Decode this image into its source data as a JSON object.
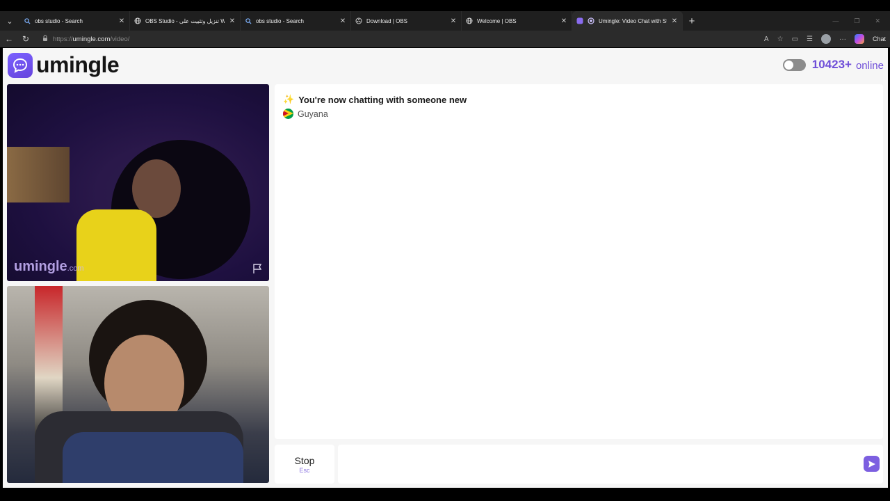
{
  "browser": {
    "tabs": [
      {
        "title": "obs studio - Search",
        "icon": "search-icon"
      },
      {
        "title": "OBS Studio - تنزيل وتثبيت على Wi",
        "icon": "globe-icon"
      },
      {
        "title": "obs studio - Search",
        "icon": "search-icon"
      },
      {
        "title": "Download | OBS",
        "icon": "obs-icon"
      },
      {
        "title": "Welcome | OBS",
        "icon": "globe-icon"
      },
      {
        "title": "Umingle: Video Chat with Stra",
        "icon": "umingle-icon",
        "active": true
      }
    ],
    "url": {
      "scheme": "https://",
      "host": "umingle.com",
      "path": "/video/"
    },
    "chat_button": "Chat"
  },
  "header": {
    "logo_text": "umingle",
    "online_count": "10423+",
    "online_label": "online",
    "toggle_on": false
  },
  "videos": {
    "remote_watermark": "umingle",
    "remote_watermark_suffix": ".com"
  },
  "chat": {
    "status_message": "You're now chatting with someone new",
    "partner_country": "Guyana"
  },
  "controls": {
    "stop_label": "Stop",
    "stop_hint": "Esc",
    "message_placeholder": ""
  },
  "colors": {
    "brand": "#6f4ed8",
    "send": "#7c5fe0"
  }
}
